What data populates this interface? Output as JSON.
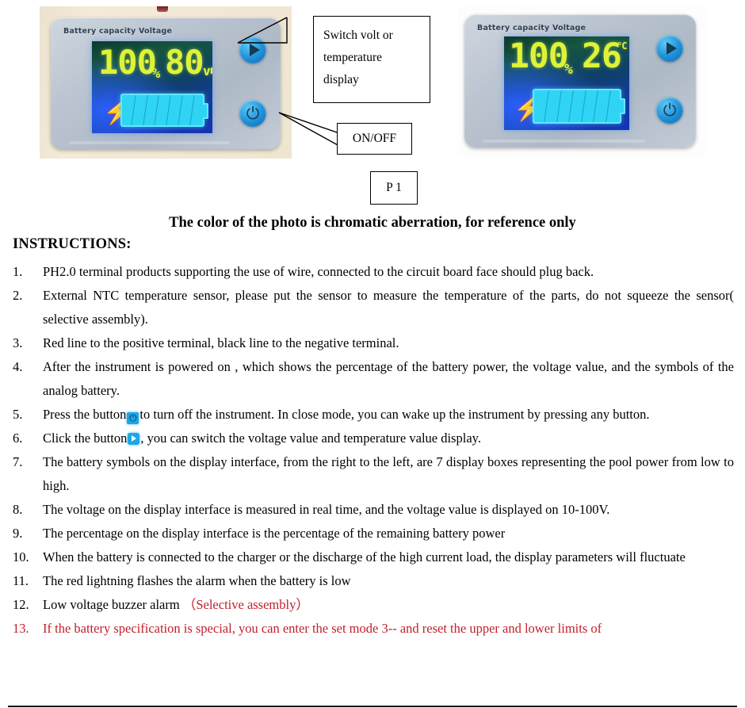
{
  "photos": {
    "left": {
      "device_caption": "Battery capacity Voltage",
      "lcd": {
        "percent": "100",
        "percent_unit": "%",
        "value": "80.0",
        "value_unit": "v",
        "battery_segments": 7,
        "lightning_icon": "lightning-bolt-icon"
      },
      "buttons": {
        "play": "play-button-icon",
        "power": "power-button-icon"
      }
    },
    "right": {
      "device_caption": "Battery capacity Voltage",
      "lcd": {
        "percent": "100",
        "percent_unit": "%",
        "value": "26",
        "value_unit": "°C",
        "battery_segments": 7,
        "lightning_icon": "lightning-bolt-icon"
      },
      "buttons": {
        "play": "play-button-icon",
        "power": "power-button-icon"
      }
    }
  },
  "callouts": {
    "switch": "Switch volt or temperature display",
    "switch_lines": [
      "Switch volt or",
      "temperature",
      "display"
    ],
    "onoff": "ON/OFF",
    "figure_label": "P 1"
  },
  "heading": "The color of the photo is chromatic aberration, for reference only",
  "instructions_title": "INSTRUCTIONS:",
  "instructions": [
    {
      "num": "1.",
      "text": "PH2.0 terminal products supporting the use of wire, connected to the circuit board face should plug back.",
      "color": "#000000"
    },
    {
      "num": "2.",
      "text": "External NTC temperature sensor, please put the sensor to measure the temperature of the parts, do not squeeze the sensor( selective assembly).",
      "color": "#000000"
    },
    {
      "num": "3.",
      "text": "Red line to the positive terminal, black line to the negative terminal.",
      "color": "#000000"
    },
    {
      "num": "4.",
      "text": "After the instrument is powered on , which shows the percentage of the battery power, the voltage value, and the symbols of the analog battery.",
      "color": "#000000"
    },
    {
      "num": "5.",
      "text_before": "Press the button",
      "inline_icon": "power-button-icon",
      "text_after": "to turn off the instrument. In close mode, you can wake up the instrument by pressing any button.",
      "color": "#000000"
    },
    {
      "num": "6.",
      "text_before": "Click the button",
      "inline_icon": "play-button-icon",
      "text_after": ", you can switch the voltage value and temperature value display.",
      "color": "#000000"
    },
    {
      "num": "7.",
      "text": "The battery symbols on the display interface, from the right to the left, are 7 display boxes representing the pool power from low to high.",
      "color": "#000000"
    },
    {
      "num": "8.",
      "text": "The voltage on the display interface is measured in real time, and the voltage value is displayed on 10-100V.",
      "color": "#000000"
    },
    {
      "num": "9.",
      "text": "The percentage on the display interface is the percentage of the remaining battery power",
      "color": "#000000"
    },
    {
      "num": "10.",
      "text": "When the battery is connected to the charger or the discharge of the high current load, the display parameters will fluctuate",
      "color": "#000000"
    },
    {
      "num": "11.",
      "text": "The red lightning flashes the alarm when the battery is low",
      "color": "#000000"
    },
    {
      "num": "12.",
      "text_black": "Low voltage buzzer alarm ",
      "text_red": "（Selective assembly）",
      "color": "#c0202c"
    },
    {
      "num": "13.",
      "text": "If the battery specification is special, you can enter the set mode 3-- and reset the upper and lower limits of",
      "color": "#c0202c"
    }
  ],
  "colors": {
    "red_text": "#c0202c",
    "lcd_digits": "#dff23a",
    "lcd_battery": "#2fd4f5",
    "button_blue": "#1d8fd8",
    "bolt_red": "#cc1f2a"
  }
}
